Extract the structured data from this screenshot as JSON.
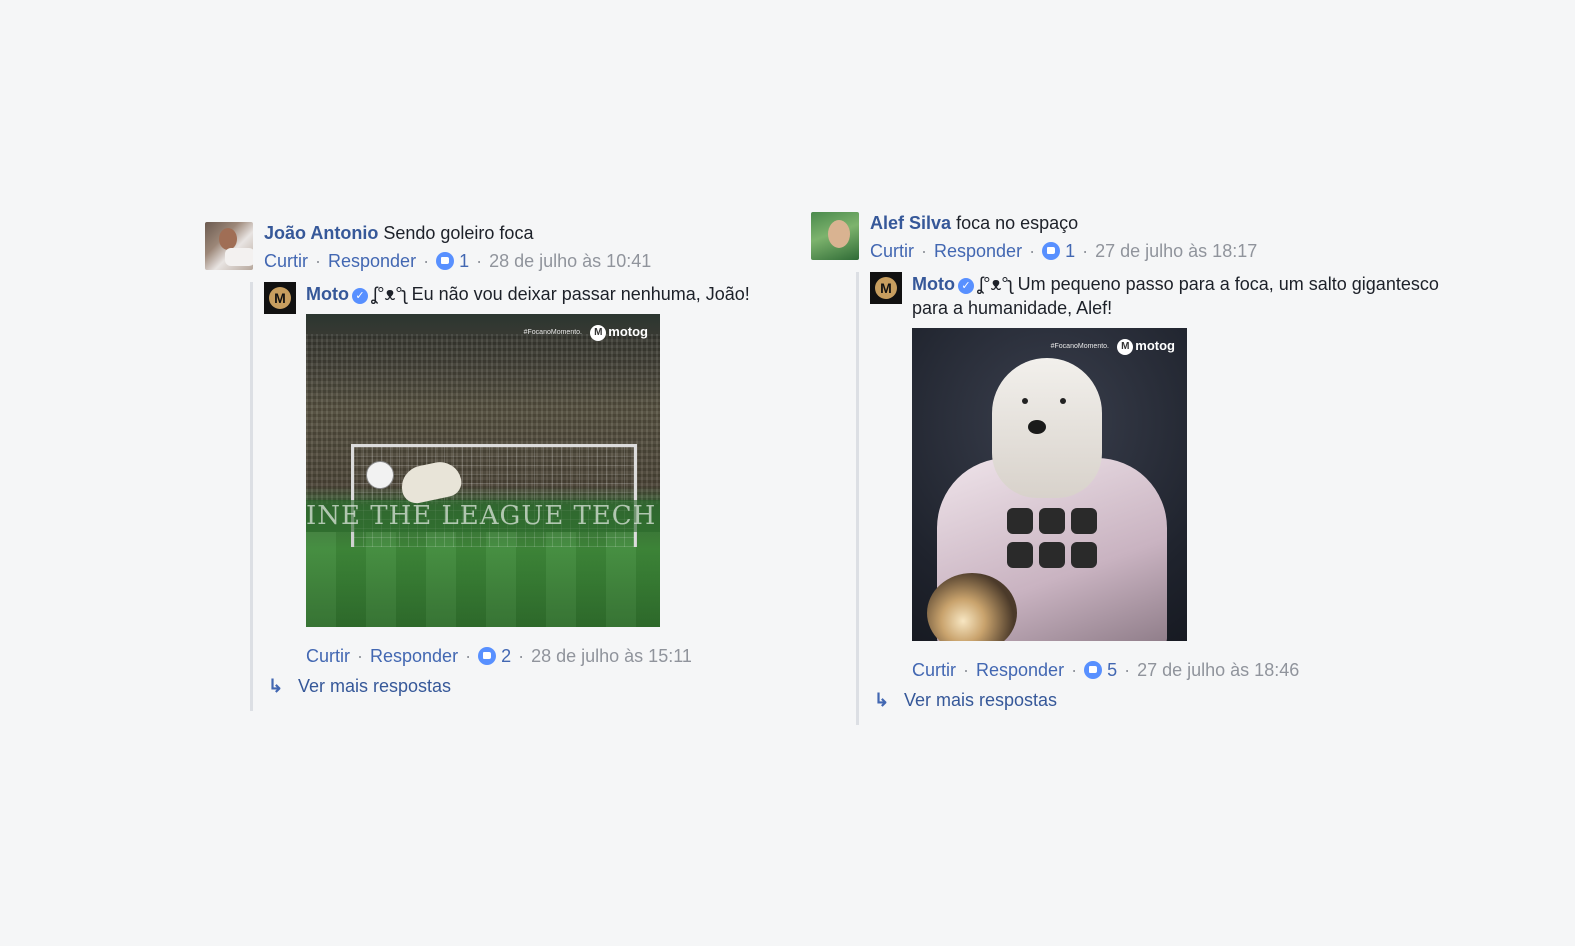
{
  "threads": [
    {
      "author": "João Antonio",
      "text": "Sendo goleiro foca",
      "actions": {
        "like": "Curtir",
        "reply": "Responder",
        "likes": "1",
        "time": "28 de julho às 10:41"
      },
      "reply": {
        "author": "Moto",
        "text": "ʆ°ᴥ°ʅ Eu não vou deixar passar nenhuma, João!",
        "photo": {
          "watermark_tag": "#FocanoMomento.",
          "watermark_brand": "motog",
          "board_text": "INE THE LEAGUE TECH SO"
        },
        "actions": {
          "like": "Curtir",
          "reply": "Responder",
          "likes": "2",
          "time": "28 de julho às 15:11"
        }
      },
      "more_replies": "Ver mais respostas"
    },
    {
      "author": "Alef Silva",
      "text": "foca no espaço",
      "actions": {
        "like": "Curtir",
        "reply": "Responder",
        "likes": "1",
        "time": "27 de julho às 18:17"
      },
      "reply": {
        "author": "Moto",
        "text": "ʆ°ᴥ°ʅ Um pequeno passo para a foca, um salto gigantesco para a humanidade, Alef!",
        "photo": {
          "watermark_tag": "#FocanoMomento.",
          "watermark_brand": "motog"
        },
        "actions": {
          "like": "Curtir",
          "reply": "Responder",
          "likes": "5",
          "time": "27 de julho às 18:46"
        }
      },
      "more_replies": "Ver mais respostas"
    }
  ],
  "icons": {
    "like": "thumbs-up-icon",
    "verified": "verified-check-icon",
    "reply_arrow": "reply-arrow-icon"
  },
  "colors": {
    "link": "#365899",
    "action": "#4267b2",
    "meta": "#90949c",
    "like_badge": "#5890ff",
    "background": "#f5f6f7"
  }
}
